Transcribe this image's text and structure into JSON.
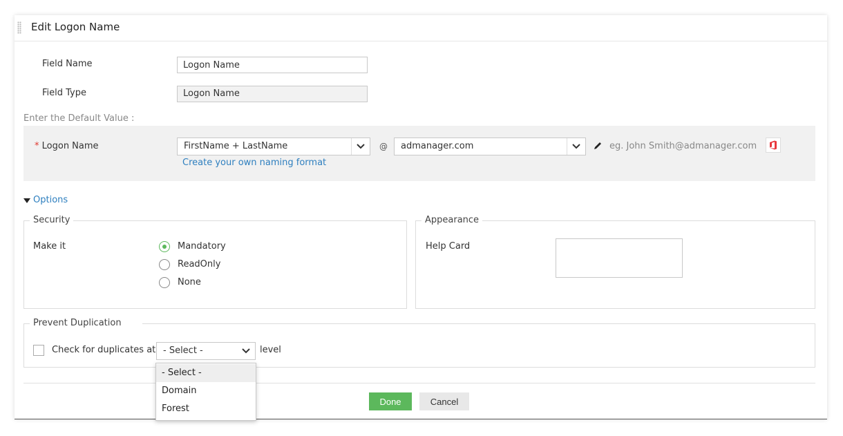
{
  "dialog": {
    "title": "Edit Logon Name"
  },
  "form": {
    "field_name_label": "Field Name",
    "field_name_value": "Logon Name",
    "field_type_label": "Field Type",
    "field_type_value": "Logon Name",
    "default_value_label": "Enter the Default Value :",
    "logon": {
      "required_marker": "*",
      "label": "Logon Name",
      "format_value": "FirstName + LastName",
      "at_sign": "@",
      "domain_value": "admanager.com",
      "example": "eg. John Smith@admanager.com",
      "create_link": "Create your own naming format"
    }
  },
  "options": {
    "toggle_label": "Options",
    "security": {
      "legend": "Security",
      "make_it_label": "Make it",
      "radios": [
        {
          "label": "Mandatory",
          "checked": true
        },
        {
          "label": "ReadOnly",
          "checked": false
        },
        {
          "label": "None",
          "checked": false
        }
      ]
    },
    "appearance": {
      "legend": "Appearance",
      "help_card_label": "Help Card"
    },
    "duplication": {
      "legend": "Prevent Duplication",
      "check_label": "Check for duplicates at",
      "level_select_value": "- Select -",
      "level_suffix": "level",
      "dropdown_options": [
        "- Select -",
        "Domain",
        "Forest"
      ]
    }
  },
  "buttons": {
    "done": "Done",
    "cancel": "Cancel"
  },
  "colors": {
    "primary": "#5cb85c",
    "link": "#2e7fbf",
    "required": "#e0382f",
    "office": "#e8383d"
  }
}
